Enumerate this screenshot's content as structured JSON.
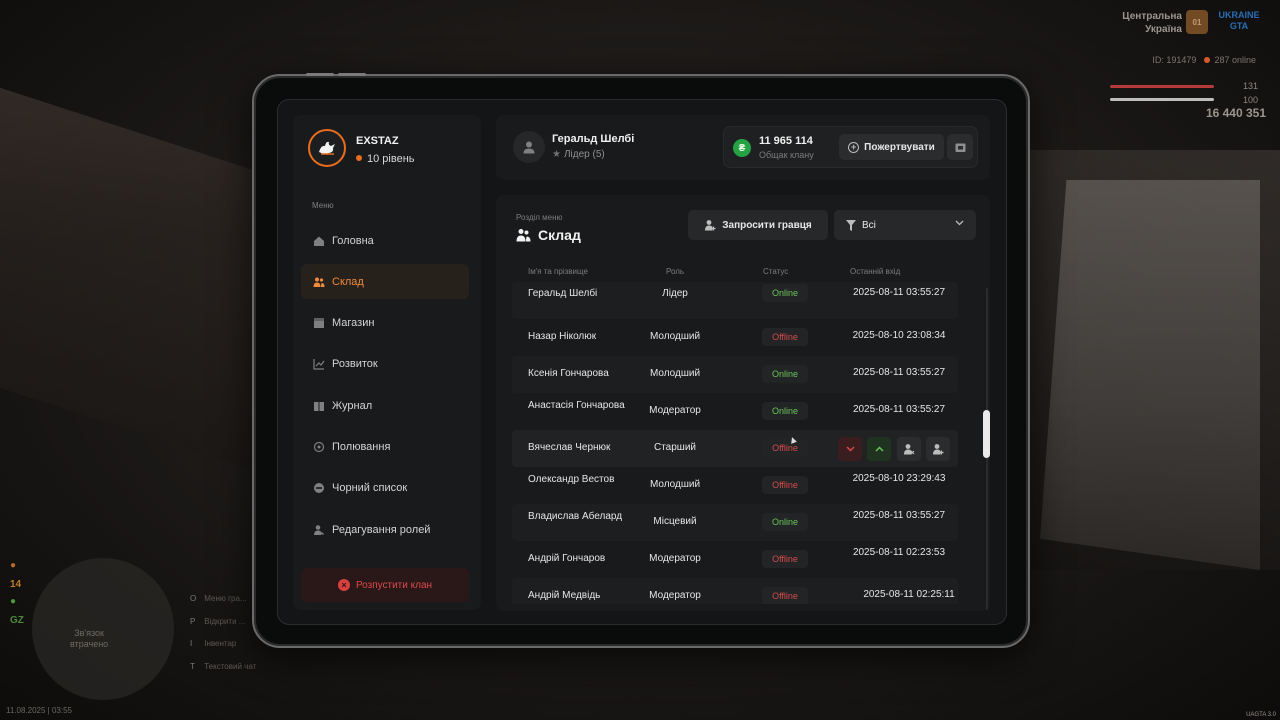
{
  "hud": {
    "region_line1": "Центральна",
    "region_line2": "Україна",
    "region_badge": "01",
    "server_logo": "UKRAINE GTA",
    "player_id": "ID: 191479",
    "online": "287 online",
    "health": "131",
    "armor": "100",
    "money": "16 440 351",
    "side_num1": "14",
    "side_num2": "GZ",
    "minimap_text_line1": "Зв'язок",
    "minimap_text_line2": "втрачено",
    "keys": [
      {
        "key": "O",
        "label": "Меню гра..."
      },
      {
        "key": "P",
        "label": "Відкрити ..."
      },
      {
        "key": "I",
        "label": "Інвентар"
      },
      {
        "key": "T",
        "label": "Текстовий чат"
      }
    ],
    "datetime": "11.08.2025 | 03:55",
    "build": "UAGTA 3.0"
  },
  "profile": {
    "name": "EXSTAZ",
    "level": "10 рівень"
  },
  "menu": {
    "caption": "Меню",
    "items": [
      {
        "label": "Головна",
        "icon": "home-icon"
      },
      {
        "label": "Склад",
        "icon": "members-icon"
      },
      {
        "label": "Магазин",
        "icon": "shop-icon"
      },
      {
        "label": "Розвиток",
        "icon": "chart-icon"
      },
      {
        "label": "Журнал",
        "icon": "book-icon"
      },
      {
        "label": "Полювання",
        "icon": "target-icon"
      },
      {
        "label": "Чорний список",
        "icon": "ban-icon"
      },
      {
        "label": "Редагування ролей",
        "icon": "user-edit-icon"
      }
    ],
    "disband": "Розпустити клан"
  },
  "leader": {
    "name": "Геральд Шелбі",
    "role": "Лідер (5)"
  },
  "bank": {
    "amount": "11 965 114",
    "caption": "Общак клану",
    "donate": "Пожертвувати"
  },
  "section": {
    "caption": "Розділ меню",
    "title": "Склад",
    "invite": "Запросити гравця",
    "filter": "Всі"
  },
  "table": {
    "headers": [
      "Ім'я та прізвище",
      "Роль",
      "Статус",
      "Останній вхід"
    ],
    "rows": [
      {
        "name": "Геральд Шелбі",
        "role": "Лідер",
        "status": "Online",
        "last": "2025-08-11 03:55:27"
      },
      {
        "name": "Назар Ніколюк",
        "role": "Молодший",
        "status": "Offline",
        "last": "2025-08-10 23:08:34"
      },
      {
        "name": "Ксенія Гончарова",
        "role": "Молодший",
        "status": "Online",
        "last": "2025-08-11 03:55:27"
      },
      {
        "name": "Анастасія Гончарова",
        "role": "Модератор",
        "status": "Online",
        "last": "2025-08-11 03:55:27"
      },
      {
        "name": "Вячеслав Чернюк",
        "role": "Старший",
        "status": "Offline",
        "last": ""
      },
      {
        "name": "Олександр Вестов",
        "role": "Молодший",
        "status": "Offline",
        "last": "2025-08-10 23:29:43"
      },
      {
        "name": "Владислав Абелард",
        "role": "Місцевий",
        "status": "Online",
        "last": "2025-08-11 03:55:27"
      },
      {
        "name": "Андрій Гончаров",
        "role": "Модератор",
        "status": "Offline",
        "last": "2025-08-11 02:23:53"
      },
      {
        "name": "Андрій Медвідь",
        "role": "Модератор",
        "status": "Offline",
        "last": "2025-08-11 02:25:11"
      }
    ]
  },
  "colors": {
    "accent": "#e86d1f",
    "online": "#6bc45a",
    "offline": "#d64b4b",
    "danger": "#d94040"
  }
}
